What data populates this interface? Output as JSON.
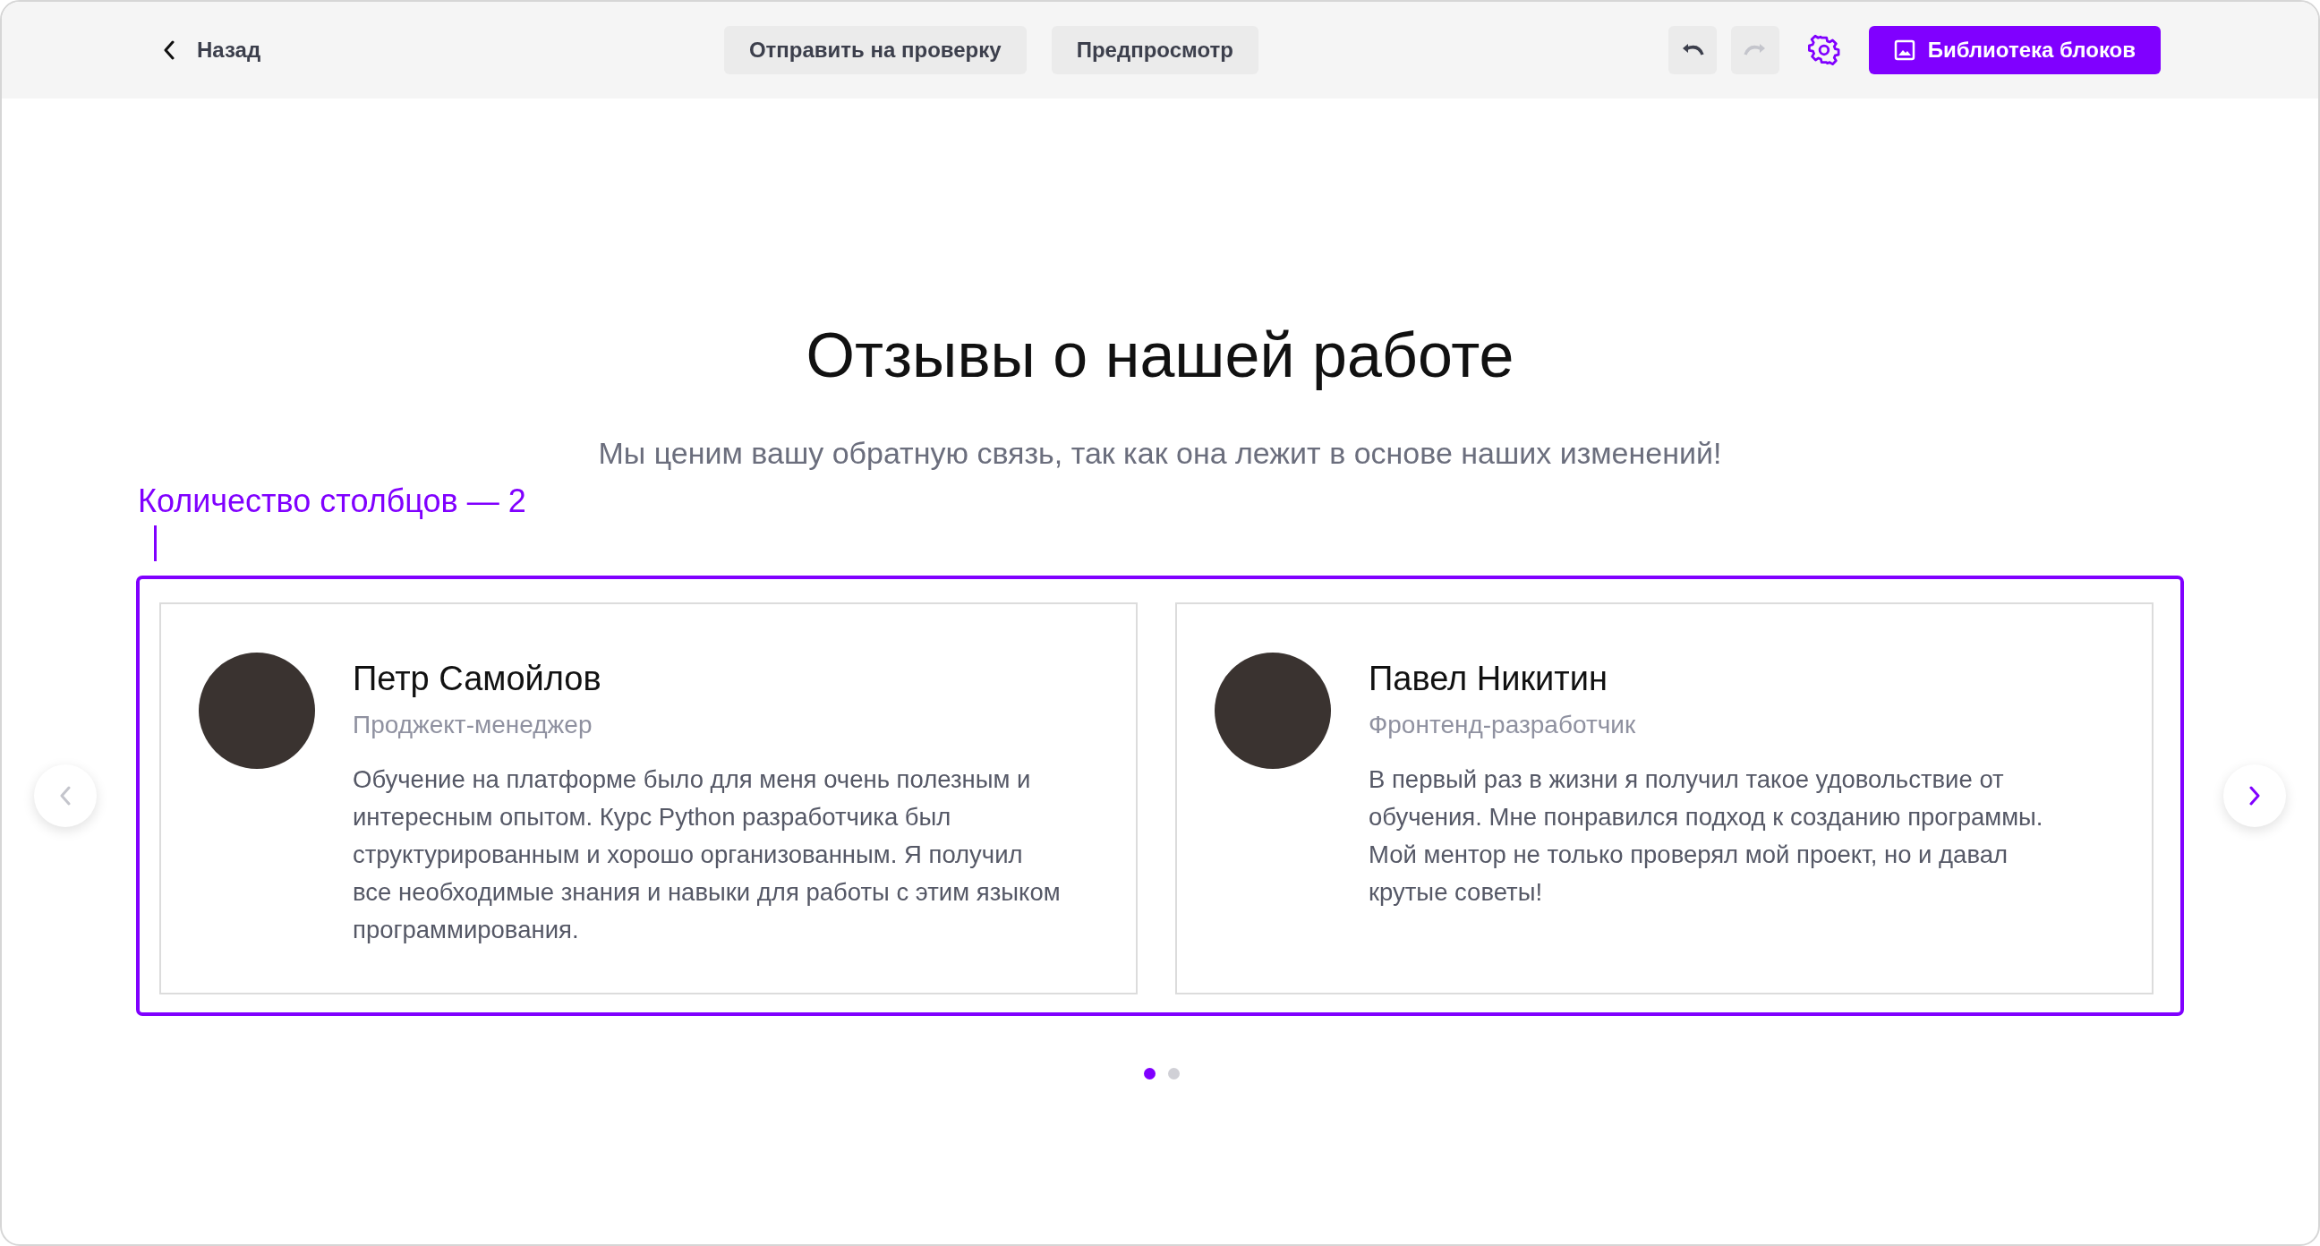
{
  "toolbar": {
    "back": "Назад",
    "buttons": [
      "Отправить на проверку",
      "Предпросмотр"
    ],
    "undo": {
      "disabled": false
    },
    "redo": {
      "disabled": true
    },
    "library_button": "Библиотека блоков"
  },
  "section": {
    "title": "Отзывы о нашей работе",
    "subtitle": "Мы ценим вашу обратную связь, так как она лежит в основе наших изменений!"
  },
  "annotation": "Количество столбцов — 2",
  "carousel": {
    "prev": {
      "disabled": true
    },
    "next": {
      "disabled": false
    },
    "cards": [
      {
        "name": "Петр Самойлов",
        "role": "Проджект-менеджер",
        "text": "Обучение на платформе было для меня очень полезным и интересным опытом. Курс Python разработчика был структурированным и хорошо организованным. Я получил все необходимые знания и навыки для работы с этим языком программирования."
      },
      {
        "name": "Павел Никитин",
        "role": "Фронтенд-разработчик",
        "text": "В первый раз в жизни я получил такое удовольствие от обучения. Мне понравился подход к созданию программы. Мой ментор не только проверял мой проект, но и давал крутые советы!"
      }
    ],
    "dots": [
      {
        "selected": true
      },
      {
        "selected": false
      }
    ]
  }
}
